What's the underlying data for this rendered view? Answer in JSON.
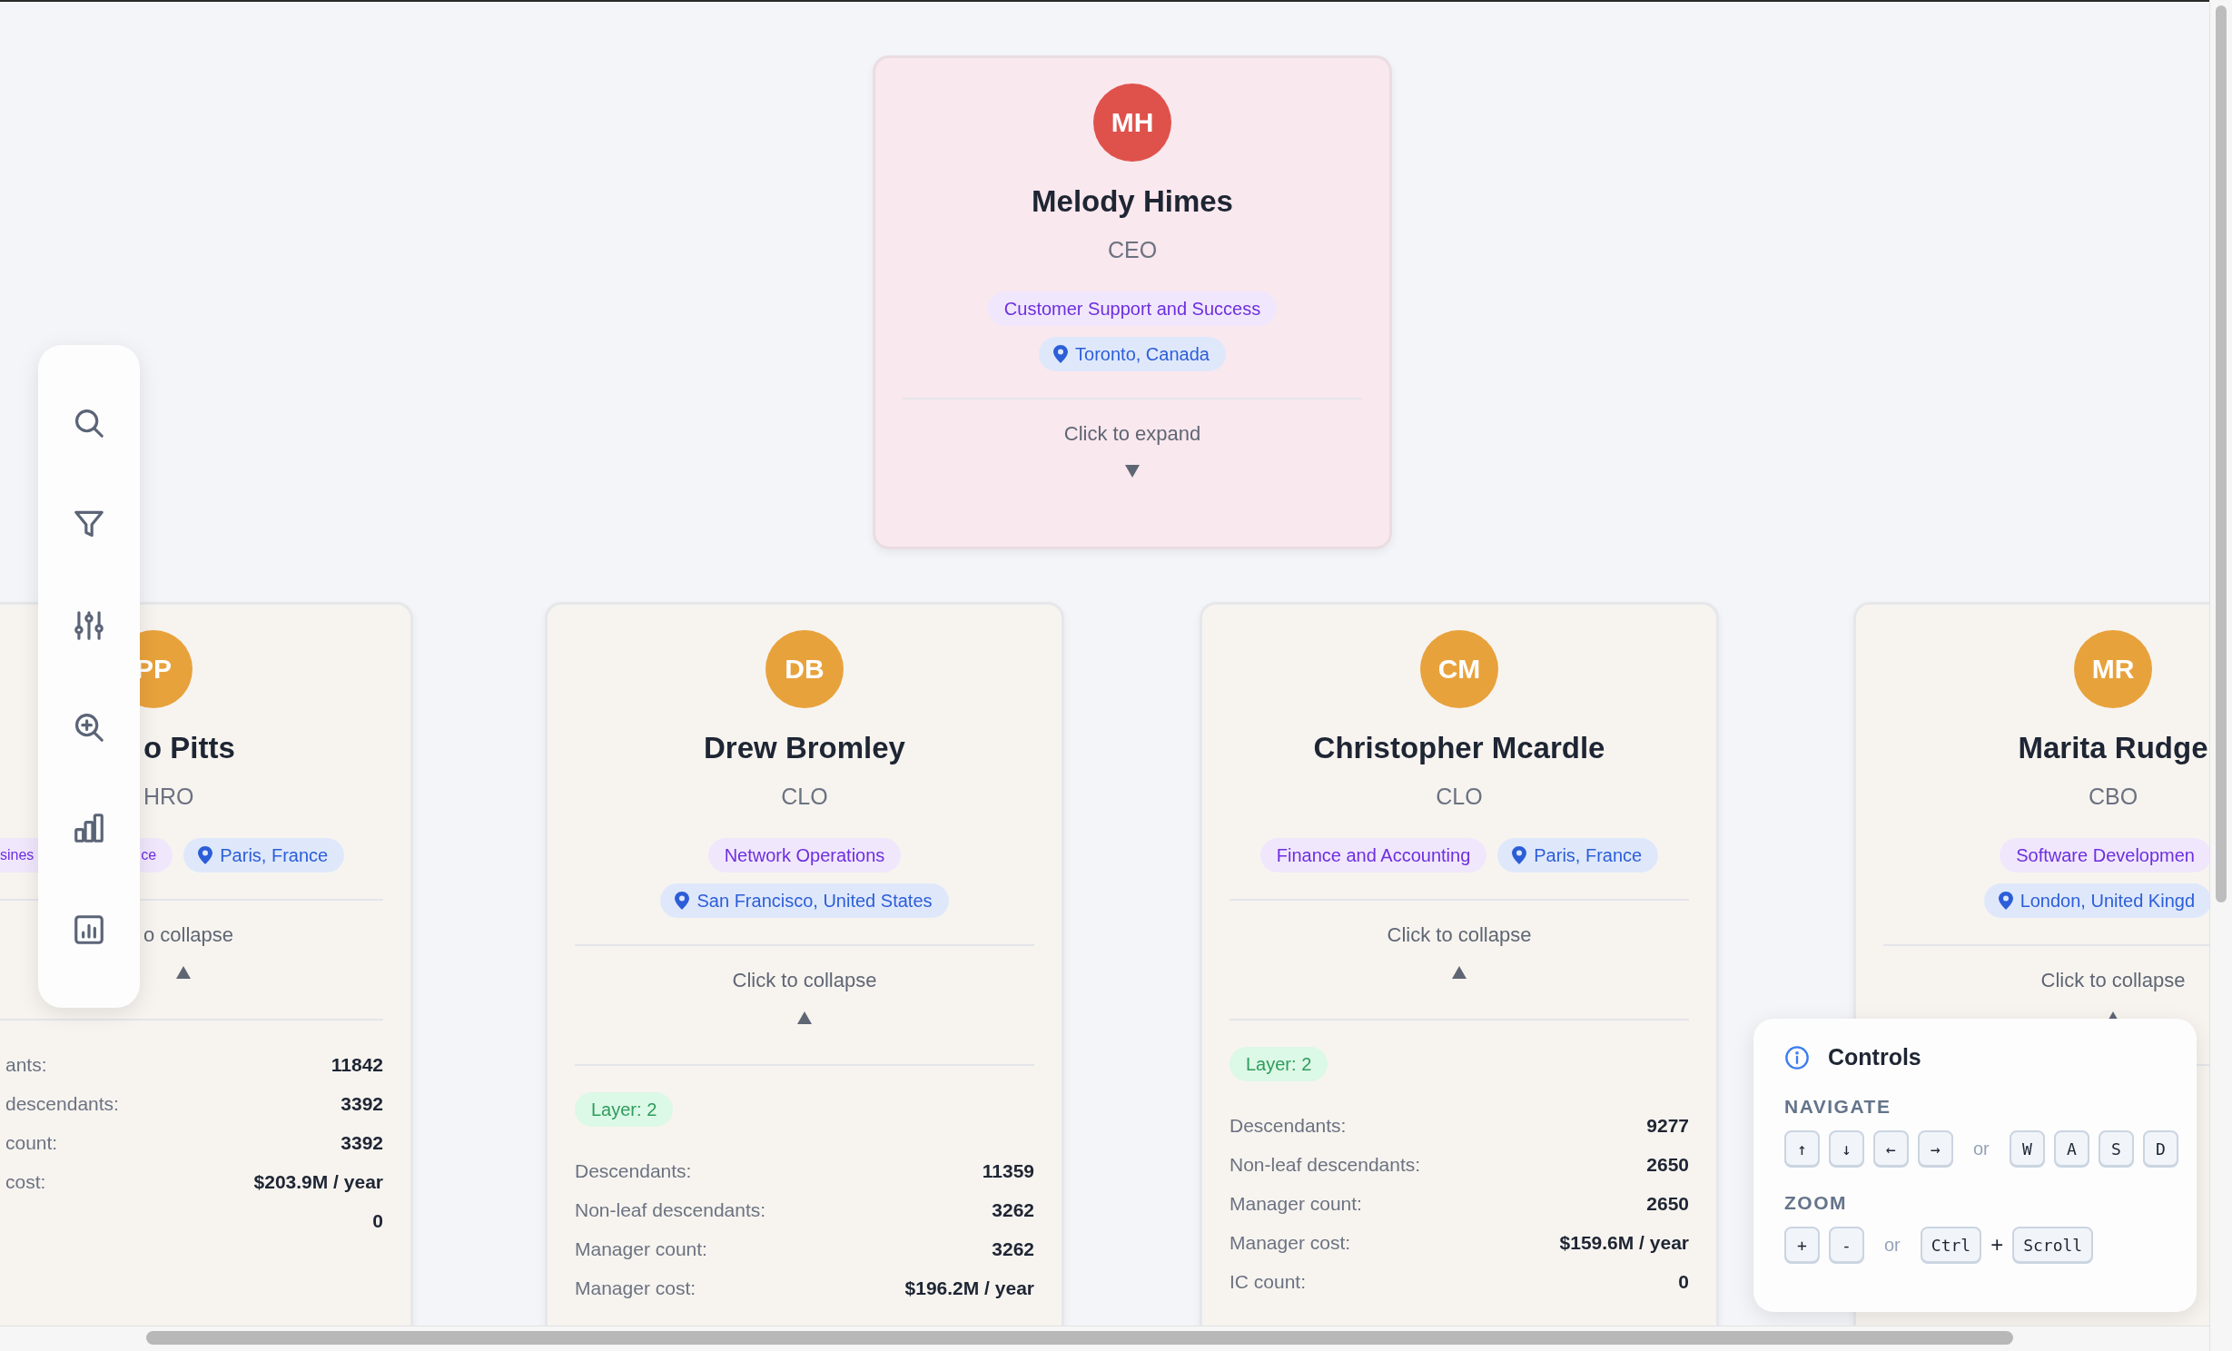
{
  "org_chart": {
    "root": {
      "initials": "MH",
      "color": "#df524b",
      "name": "Melody Himes",
      "role": "CEO",
      "department": "Customer Support and Success",
      "location": "Toronto, Canada",
      "selected": true,
      "expanded": false,
      "toggle_hint": "Click to expand"
    },
    "children": [
      {
        "initials": "PP",
        "color": "#e8a23c",
        "name": "o Pitts",
        "role": "HRO",
        "department_parts": [
          "sines",
          "ce"
        ],
        "location": "Paris, France",
        "selected": false,
        "expanded": true,
        "toggle_hint": "o collapse",
        "stats": [
          {
            "label": "ants:",
            "value": "11842"
          },
          {
            "label": "descendants:",
            "value": "3392"
          },
          {
            "label": "count:",
            "value": "3392"
          },
          {
            "label": "cost:",
            "value": "$203.9M / year"
          },
          {
            "value": "0"
          }
        ]
      },
      {
        "initials": "DB",
        "color": "#e8a23c",
        "name": "Drew Bromley",
        "role": "CLO",
        "department": "Network Operations",
        "location": "San Francisco, United States",
        "selected": false,
        "expanded": true,
        "toggle_hint": "Click to collapse",
        "layer": "Layer: 2",
        "stats": [
          {
            "label": "Descendants:",
            "value": "11359"
          },
          {
            "label": "Non-leaf descendants:",
            "value": "3262"
          },
          {
            "label": "Manager count:",
            "value": "3262"
          },
          {
            "label": "Manager cost:",
            "value": "$196.2M / year"
          }
        ]
      },
      {
        "initials": "CM",
        "color": "#e8a23c",
        "name": "Christopher Mcardle",
        "role": "CLO",
        "department": "Finance and Accounting",
        "location": "Paris, France",
        "selected": false,
        "expanded": true,
        "toggle_hint": "Click to collapse",
        "layer": "Layer: 2",
        "stats": [
          {
            "label": "Descendants:",
            "value": "9277"
          },
          {
            "label": "Non-leaf descendants:",
            "value": "2650"
          },
          {
            "label": "Manager count:",
            "value": "2650"
          },
          {
            "label": "Manager cost:",
            "value": "$159.6M / year"
          },
          {
            "label": "IC count:",
            "value": "0"
          }
        ]
      },
      {
        "initials": "MR",
        "color": "#e8a23c",
        "name": "Marita Rudge",
        "role": "CBO",
        "department": "Software Developmen",
        "location": "London, United Kingd",
        "selected": false,
        "expanded": true,
        "toggle_hint": "Click to collapse"
      }
    ]
  },
  "controls": {
    "title": "Controls",
    "sections": [
      {
        "heading": "NAVIGATE",
        "items": [
          {
            "kind": "key",
            "text": "↑"
          },
          {
            "kind": "key",
            "text": "↓"
          },
          {
            "kind": "key",
            "text": "←"
          },
          {
            "kind": "key",
            "text": "→"
          },
          {
            "kind": "separator",
            "text": "or"
          },
          {
            "kind": "key",
            "text": "W"
          },
          {
            "kind": "key",
            "text": "A"
          },
          {
            "kind": "key",
            "text": "S"
          },
          {
            "kind": "key",
            "text": "D"
          }
        ]
      },
      {
        "heading": "ZOOM",
        "items": [
          {
            "kind": "key",
            "text": "+"
          },
          {
            "kind": "key",
            "text": "-"
          },
          {
            "kind": "separator",
            "text": "or"
          },
          {
            "kind": "key",
            "text": "Ctrl"
          },
          {
            "kind": "plus",
            "text": "+"
          },
          {
            "kind": "key",
            "text": "Scroll"
          }
        ]
      }
    ]
  }
}
